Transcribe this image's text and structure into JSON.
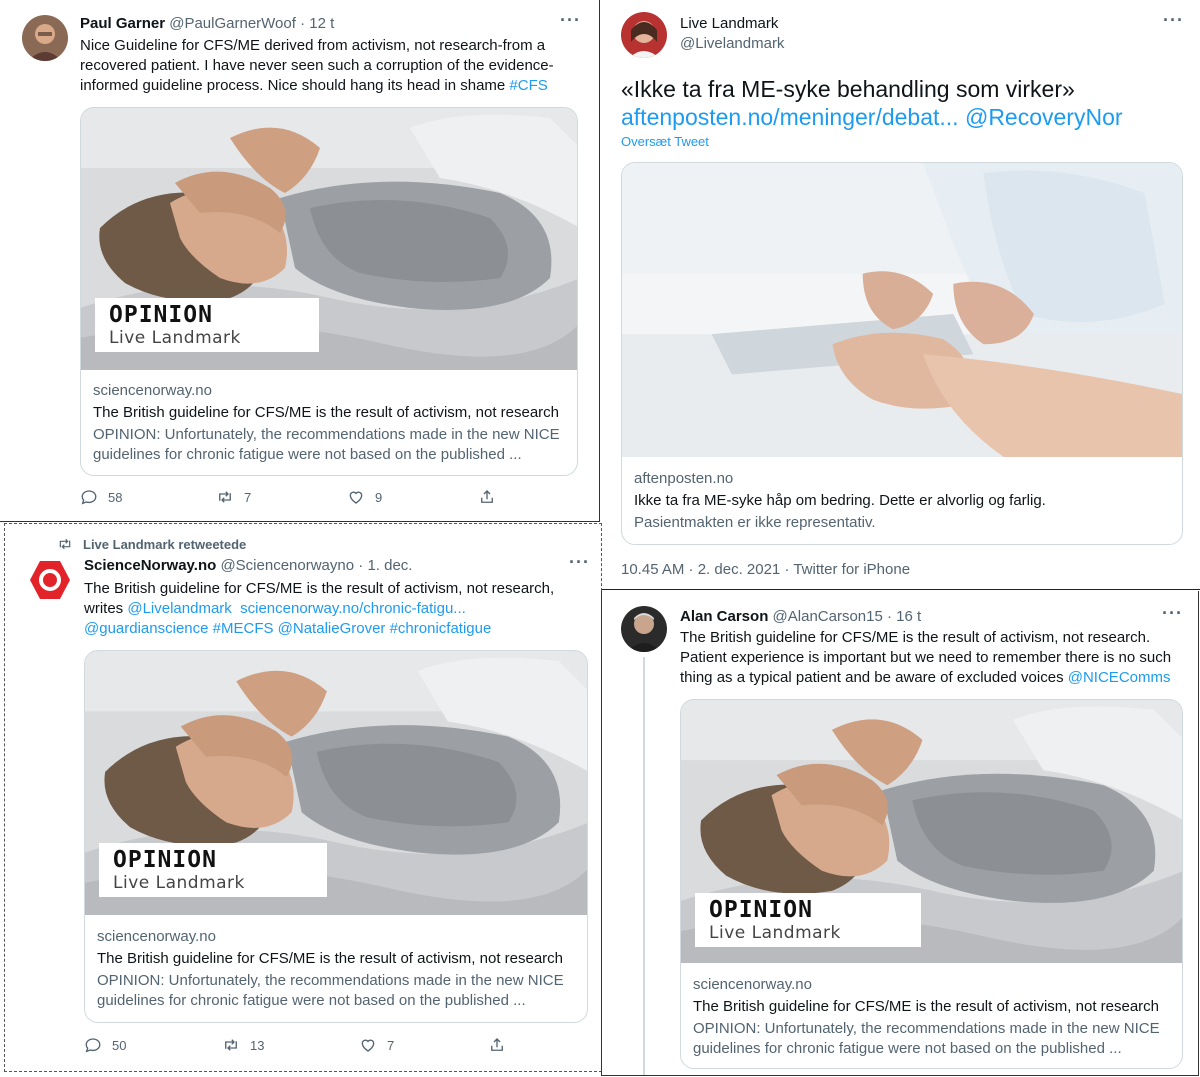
{
  "tweet1": {
    "name": "Paul Garner",
    "handle": "@PaulGarnerWoof",
    "time": "12 t",
    "text_line1": "Nice Guideline for CFS/ME derived from activism, not  research-from a",
    "text_line2": "recovered patient. I have never seen such a corruption of the evidence-",
    "text_line3": "informed guideline process. Nice should hang its head in shame ",
    "hashtag": "#CFS",
    "card": {
      "opinion": "OPINION",
      "author": "Live Landmark",
      "domain": "sciencenorway.no",
      "title": "The British guideline for CFS/ME is the result of activism, not research",
      "desc_line1": "OPINION: Unfortunately, the recommendations made in the new NICE",
      "desc_line2": "guidelines for chronic fatigue were not based on the published ..."
    },
    "replies": "58",
    "retweets": "7",
    "likes": "9"
  },
  "tweet2": {
    "name": "Live Landmark",
    "handle": "@Livelandmark",
    "quote": "«Ikke ta fra ME-syke behandling som virker»",
    "link1": "aftenposten.no/meninger/debat...",
    "link2": "@RecoveryNor",
    "translate": "Oversæt Tweet",
    "card": {
      "domain": "aftenposten.no",
      "title": "Ikke ta fra ME-syke håp om bedring. Dette er alvorlig og farlig.",
      "desc": "Pasientmakten er ikke representativ."
    },
    "timestamp": "10.45 AM · 2. dec. 2021 · Twitter for iPhone"
  },
  "tweet3": {
    "retweeted_by": "Live Landmark retweetede",
    "name": "ScienceNorway.no",
    "handle": "@Sciencenorwayno",
    "time": "1. dec.",
    "text_line1": "The British guideline for CFS/ME is the result of activism, not research,",
    "text_writes": "writes ",
    "mention1": "@Livelandmark",
    "url": "sciencenorway.no/chronic-fatigu...",
    "mention2": "@guardianscience",
    "tag1": "#MECFS",
    "mention3": "@NatalieGrover",
    "tag2": "#chronicfatigue",
    "card": {
      "opinion": "OPINION",
      "author": "Live Landmark",
      "domain": "sciencenorway.no",
      "title": "The British guideline for CFS/ME is the result of activism, not research",
      "desc_line1": "OPINION: Unfortunately, the recommendations made in the new NICE",
      "desc_line2": "guidelines for chronic fatigue were not based on the published ..."
    },
    "replies": "50",
    "retweets": "13",
    "likes": "7"
  },
  "tweet4": {
    "name": "Alan Carson",
    "handle": "@AlanCarson15",
    "time": "16 t",
    "text_line1": "The British guideline for CFS/ME is the result of activism, not research.",
    "text_line2": "Patient experience is important but we need to remember there is no such",
    "text_line3": "thing as a typical patient and be aware of excluded voices ",
    "mention": "@NICEComms",
    "card": {
      "opinion": "OPINION",
      "author": "Live Landmark",
      "domain": "sciencenorway.no",
      "title": "The British guideline for CFS/ME is the result of activism, not research",
      "desc_line1": "OPINION: Unfortunately, the recommendations made in the new NICE",
      "desc_line2": "guidelines for chronic fatigue were not based on the published ..."
    }
  },
  "more_label": "···",
  "colors": {
    "link": "#1d9bf0",
    "muted": "#536471",
    "border": "#cfd9de",
    "text": "#0f1419"
  }
}
